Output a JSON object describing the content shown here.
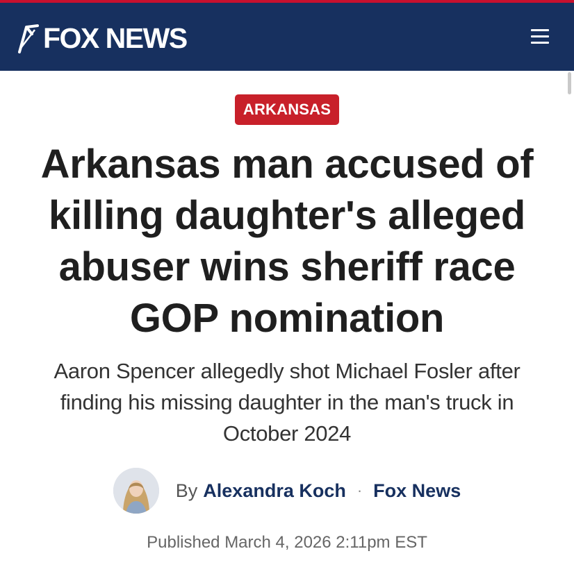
{
  "header": {
    "logo_text": "FOX NEWS",
    "logo_icon": "fox-news-searchlight-icon",
    "menu_icon": "hamburger-menu-icon",
    "background_color": "#17305f",
    "stripe_color": "#c8102e"
  },
  "article": {
    "category": "ARKANSAS",
    "category_color": "#c8202a",
    "headline": "Arkansas man accused of killing daughter's alleged abuser wins sheriff race GOP nomination",
    "subheadline": "Aaron Spencer allegedly shot Michael Fosler after finding his missing daughter in the man's truck in October 2024",
    "byline_prefix": "By",
    "author": "Alexandra Koch",
    "separator": "·",
    "outlet": "Fox News",
    "published": "Published March 4, 2026 2:11pm EST"
  }
}
